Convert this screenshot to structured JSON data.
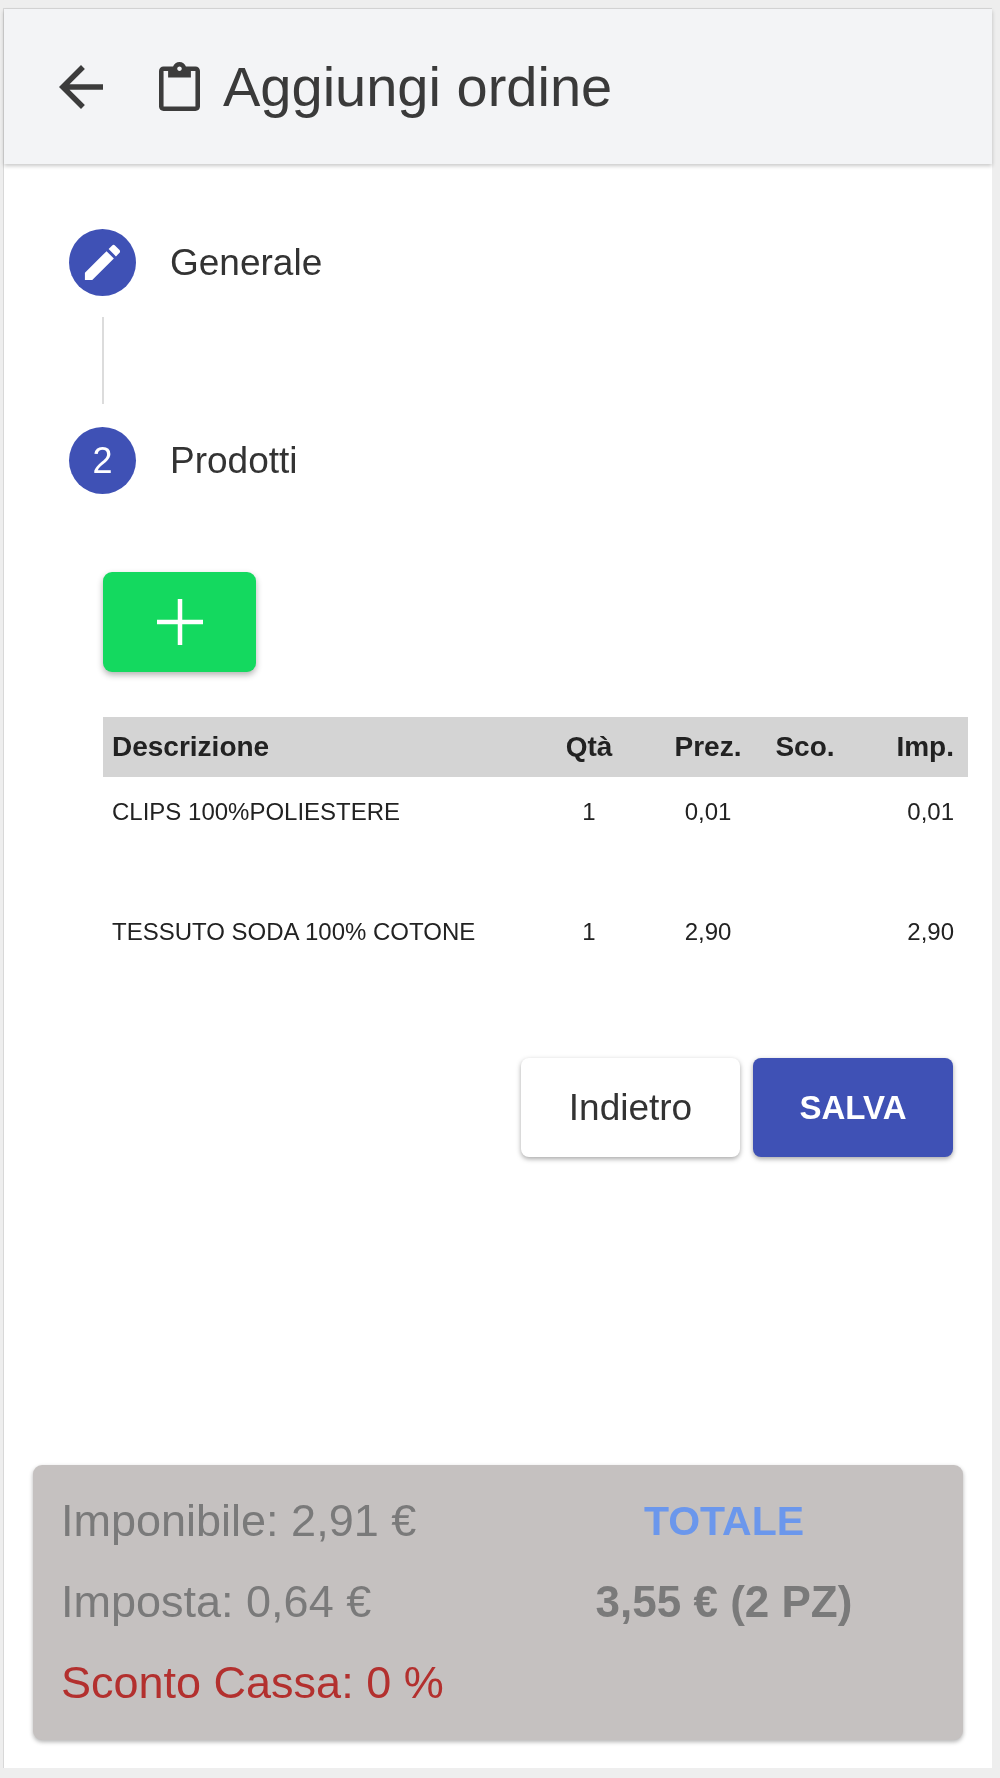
{
  "header": {
    "title": "Aggiungi ordine"
  },
  "stepper": {
    "steps": [
      {
        "kind": "edit",
        "label": "Generale"
      },
      {
        "kind": "number",
        "number": "2",
        "label": "Prodotti"
      }
    ]
  },
  "table": {
    "columns": [
      "Descrizione",
      "Qtà",
      "Prez.",
      "Sco.",
      "Imp."
    ],
    "rows": [
      {
        "description": "CLIPS 100%POLIESTERE",
        "qty": "1",
        "price": "0,01",
        "amount": "0,01"
      },
      {
        "description": "TESSUTO SODA 100% COTONE",
        "qty": "1",
        "price": "2,90",
        "amount": "2,90"
      }
    ]
  },
  "actions": [
    {
      "kind": "secondary",
      "label": "Indietro"
    },
    {
      "kind": "primary",
      "label": "SALVA"
    }
  ],
  "summary": {
    "lines": [
      {
        "kind": "amount",
        "text": "Imponibile: 2,91 €"
      },
      {
        "kind": "amount",
        "text": "Imposta: 0,64 €"
      },
      {
        "kind": "discount",
        "text": "Sconto Cassa: 0 %"
      }
    ],
    "total": {
      "label": "TOTALE",
      "value": "3,55 € (2 PZ)"
    }
  }
}
